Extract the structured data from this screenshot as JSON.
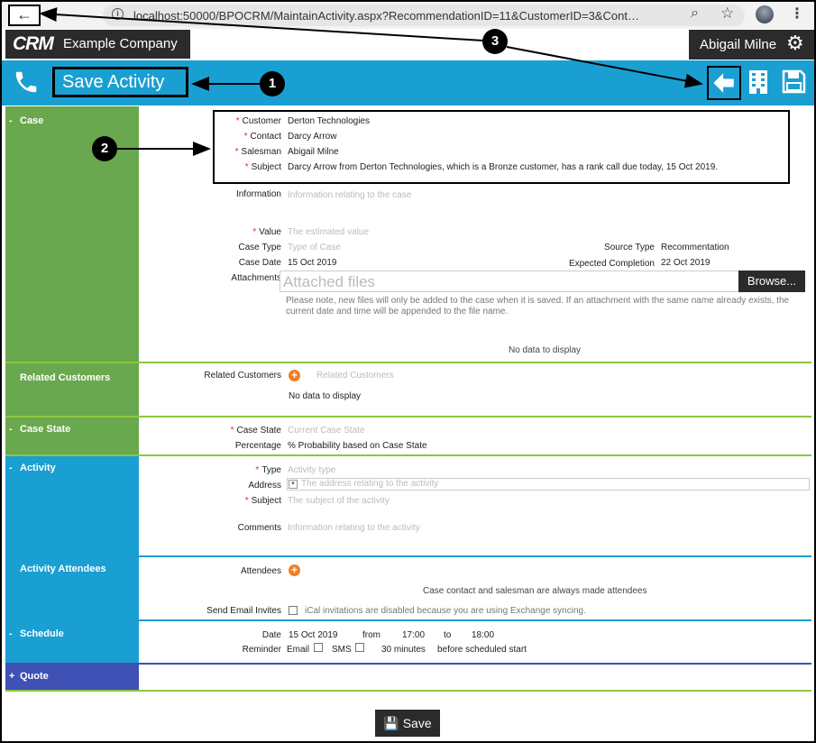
{
  "browser": {
    "url": "localhost:50000/BPOCRM/MaintainActivity.aspx?RecommendationID=11&CustomerID=3&Cont…",
    "back_glyph": "←",
    "info_glyph": "i",
    "zoom_glyph": "⌕",
    "star_glyph": "☆",
    "menu_glyph": "⋮"
  },
  "header": {
    "logo": "CRM",
    "company": "Example Company",
    "user": "Abigail Milne",
    "gear_glyph": "⚙"
  },
  "action_bar": {
    "title": "Save Activity"
  },
  "callouts": [
    "1",
    "2",
    "3"
  ],
  "sections": {
    "case": {
      "toggle": "-",
      "title": "Case",
      "customer_label": "Customer",
      "customer": "Derton Technologies",
      "contact_label": "Contact",
      "contact": "Darcy Arrow",
      "salesman_label": "Salesman",
      "salesman": "Abigail Milne",
      "subject_label": "Subject",
      "subject": "Darcy Arrow from Derton Technologies, which is a Bronze customer, has a rank call due today, 15 Oct 2019.",
      "information_label": "Information",
      "information_placeholder": "Information relating to the case",
      "value_label": "Value",
      "value_placeholder": "The estimated value",
      "case_type_label": "Case Type",
      "case_type_placeholder": "Type of Case",
      "source_type_label": "Source Type",
      "source_type": "Recommentation",
      "case_date_label": "Case Date",
      "case_date": "15 Oct 2019",
      "expected_label": "Expected Completion",
      "expected": "22 Oct 2019",
      "attachments_label": "Attachments",
      "attachments_placeholder": "Attached files",
      "browse": "Browse...",
      "attach_note": "Please note, new files will only be added to the case when it is saved. If an attachment with the same name already exists, the current date and time will be appended to the file name.",
      "no_data": "No data to display"
    },
    "related": {
      "title": "Related Customers",
      "label": "Related Customers",
      "placeholder": "Related Customers",
      "no_data": "No data to display"
    },
    "case_state": {
      "toggle": "-",
      "title": "Case State",
      "state_label": "Case State",
      "state_placeholder": "Current Case State",
      "percentage_label": "Percentage",
      "percentage": "% Probability based on Case State"
    },
    "activity": {
      "toggle": "-",
      "title": "Activity",
      "type_label": "Type",
      "type_placeholder": "Activity type",
      "address_label": "Address",
      "address_placeholder": "The address relating to the activity",
      "subject_label": "Subject",
      "subject_placeholder": "The subject of the activity",
      "comments_label": "Comments",
      "comments_placeholder": "Information relating to the activity"
    },
    "attendees": {
      "title": "Activity Attendees",
      "label": "Attendees",
      "note": "Case contact and salesman are always made attendees",
      "send_label": "Send Email Invites",
      "send_note": "iCal invitations are disabled because you are using Exchange syncing."
    },
    "schedule": {
      "toggle": "-",
      "title": "Schedule",
      "date_label": "Date",
      "date": "15 Oct 2019",
      "from": "from",
      "from_time": "17:00",
      "to": "to",
      "to_time": "18:00",
      "reminder_label": "Reminder",
      "email": "Email",
      "sms": "SMS",
      "minutes": "30 minutes",
      "before": "before scheduled start"
    },
    "quote": {
      "toggle": "+",
      "title": "Quote"
    }
  },
  "footer": {
    "save": "Save"
  }
}
